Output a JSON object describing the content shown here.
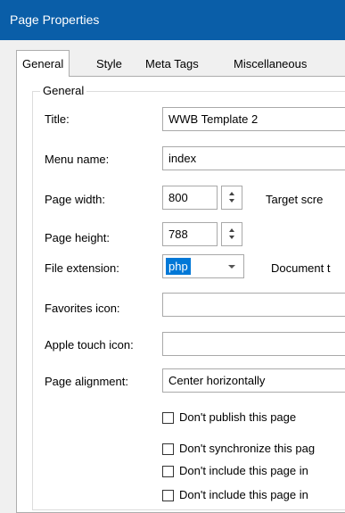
{
  "window": {
    "title": "Page Properties"
  },
  "tabs": [
    {
      "label": "General",
      "active": true
    },
    {
      "label": "Style",
      "active": false
    },
    {
      "label": "Meta Tags",
      "active": false
    },
    {
      "label": "Miscellaneous",
      "active": false
    }
  ],
  "group": {
    "label": "General"
  },
  "fields": {
    "title": {
      "label": "Title:",
      "value": "WWB Template 2"
    },
    "menu_name": {
      "label": "Menu name:",
      "value": "index"
    },
    "page_width": {
      "label": "Page width:",
      "value": "800",
      "aside": "Target scre"
    },
    "page_height": {
      "label": "Page height:",
      "value": "788"
    },
    "file_extension": {
      "label": "File extension:",
      "value": "php",
      "aside": "Document t"
    },
    "favorites_icon": {
      "label": "Favorites icon:",
      "value": ""
    },
    "apple_touch_icon": {
      "label": "Apple touch icon:",
      "value": ""
    },
    "page_alignment": {
      "label": "Page alignment:",
      "value": "Center horizontally"
    }
  },
  "checkboxes": [
    {
      "label": "Don't publish this page",
      "checked": false
    },
    {
      "label": "Don't synchronize this pag",
      "checked": false
    },
    {
      "label": "Don't include this page in",
      "checked": false
    },
    {
      "label": "Don't include this page in",
      "checked": false
    }
  ],
  "colors": {
    "titlebar": "#0a5ea8",
    "selection": "#0078d7"
  }
}
